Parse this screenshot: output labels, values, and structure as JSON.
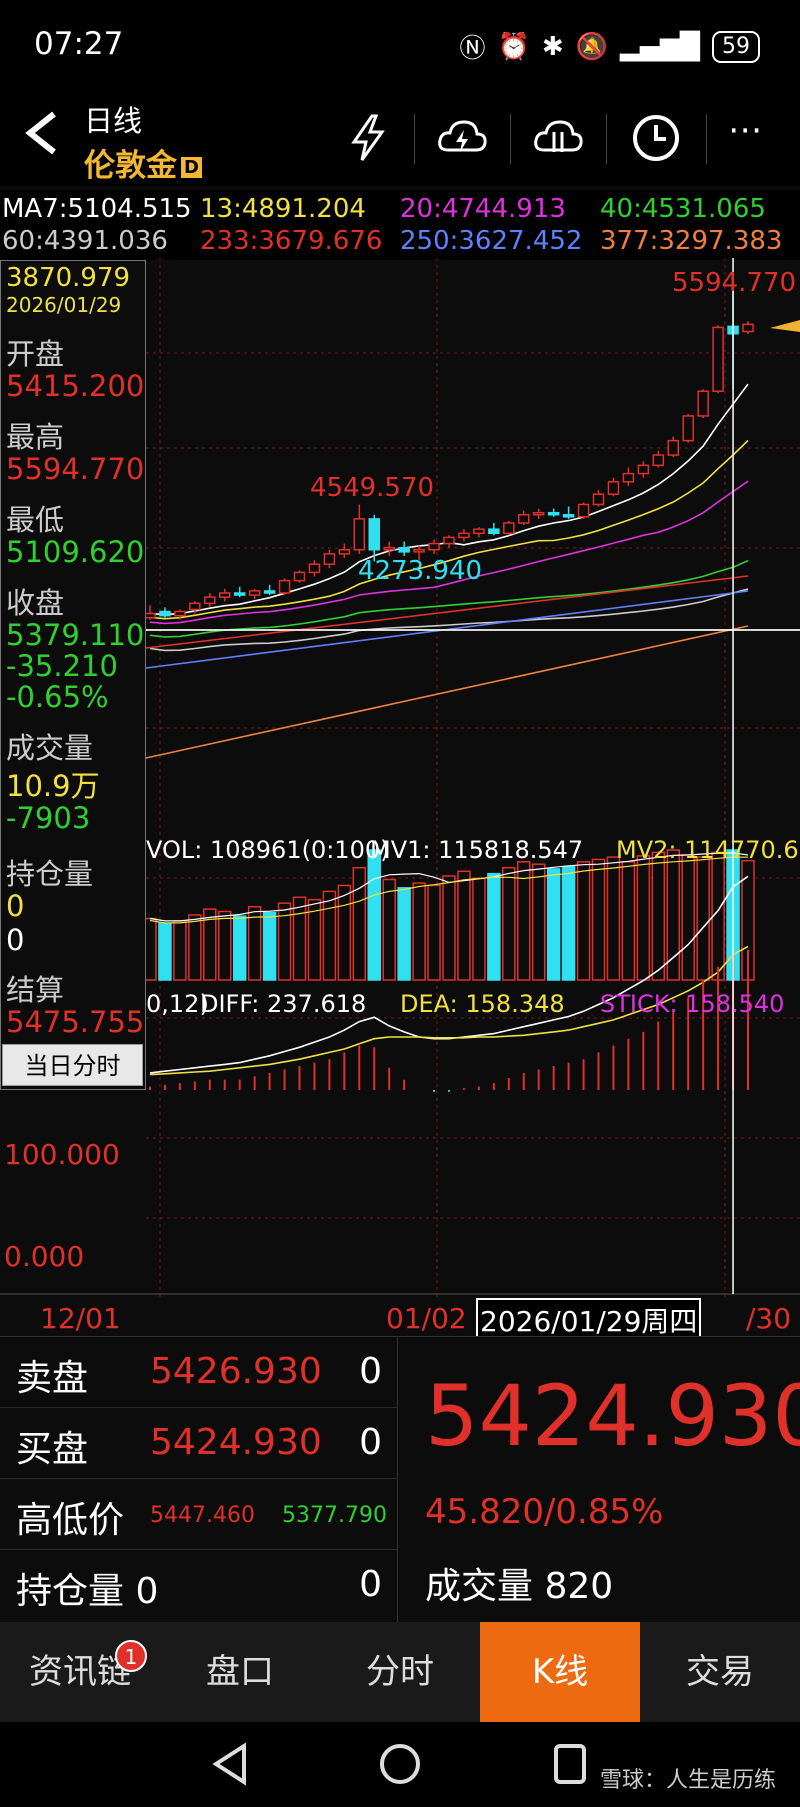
{
  "status": {
    "time": "07:27",
    "battery": "59"
  },
  "header": {
    "period": "日线",
    "instrument": "伦敦金",
    "badge": "D"
  },
  "ma_line1": [
    {
      "t": "MA7:5104.515",
      "c": "#ffffff"
    },
    {
      "t": "13:4891.204",
      "c": "#f0e040"
    },
    {
      "t": "20:4744.913",
      "c": "#e030e0"
    },
    {
      "t": "40:4531.065",
      "c": "#30d030"
    }
  ],
  "ma_line2": [
    {
      "t": "60:4391.036",
      "c": "#cccccc"
    },
    {
      "t": "233:3679.676",
      "c": "#e0302a"
    },
    {
      "t": "250:3627.452",
      "c": "#6080ff"
    },
    {
      "t": "377:3297.383",
      "c": "#f08040"
    }
  ],
  "info": {
    "price": "3870.979",
    "date": "2026/01/29",
    "open_label": "开盘",
    "open": "5415.200",
    "high_label": "最高",
    "high": "5594.770",
    "low_label": "最低",
    "low": "5109.620",
    "close_label": "收盘",
    "close": "5379.110",
    "change": "-35.210",
    "change_pct": "-0.65%",
    "volume_label": "成交量",
    "volume": "10.9万",
    "volume_change": "-7903",
    "oi_label": "持仓量",
    "oi": "0",
    "oi_change": "0",
    "settle_label": "结算",
    "settle": "5475.755",
    "intraday_button": "当日分时"
  },
  "chart_labels": {
    "max_mark": "5594.770",
    "peak_mark": "4549.570",
    "low_mark": "4273.940",
    "vol": "VOL: 108961(0:100)",
    "mv1": "MV1: 115818.547",
    "mv2": "MV2: 114770.625",
    "macd_param": "0,12)",
    "diff": "DIFF: 237.618",
    "dea": "DEA: 158.348",
    "stick": "STICK: 158.540",
    "macd_100": "100.000",
    "macd_0": "0.000",
    "x1": "12/01",
    "x2": "01/02",
    "x_cursor": "2026/01/29周四",
    "x3": "/30"
  },
  "chart_data": {
    "type": "candlestick",
    "candles": [
      {
        "o": 4000,
        "h": 4060,
        "l": 3990,
        "c": 4020
      },
      {
        "o": 4030,
        "h": 4050,
        "l": 4000,
        "c": 4010
      },
      {
        "o": 4010,
        "h": 4040,
        "l": 3990,
        "c": 4030
      },
      {
        "o": 4040,
        "h": 4080,
        "l": 4020,
        "c": 4070
      },
      {
        "o": 4070,
        "h": 4120,
        "l": 4050,
        "c": 4100
      },
      {
        "o": 4100,
        "h": 4140,
        "l": 4080,
        "c": 4120
      },
      {
        "o": 4120,
        "h": 4150,
        "l": 4100,
        "c": 4110
      },
      {
        "o": 4110,
        "h": 4140,
        "l": 4090,
        "c": 4130
      },
      {
        "o": 4130,
        "h": 4160,
        "l": 4110,
        "c": 4120
      },
      {
        "o": 4120,
        "h": 4190,
        "l": 4110,
        "c": 4180
      },
      {
        "o": 4180,
        "h": 4230,
        "l": 4170,
        "c": 4220
      },
      {
        "o": 4220,
        "h": 4280,
        "l": 4200,
        "c": 4260
      },
      {
        "o": 4260,
        "h": 4330,
        "l": 4240,
        "c": 4310
      },
      {
        "o": 4310,
        "h": 4360,
        "l": 4290,
        "c": 4330
      },
      {
        "o": 4330,
        "h": 4549.57,
        "l": 4310,
        "c": 4480
      },
      {
        "o": 4480,
        "h": 4500,
        "l": 4273.94,
        "c": 4330
      },
      {
        "o": 4330,
        "h": 4370,
        "l": 4300,
        "c": 4340
      },
      {
        "o": 4340,
        "h": 4370,
        "l": 4300,
        "c": 4320
      },
      {
        "o": 4320,
        "h": 4350,
        "l": 4280,
        "c": 4330
      },
      {
        "o": 4330,
        "h": 4380,
        "l": 4310,
        "c": 4360
      },
      {
        "o": 4360,
        "h": 4400,
        "l": 4340,
        "c": 4390
      },
      {
        "o": 4390,
        "h": 4430,
        "l": 4370,
        "c": 4410
      },
      {
        "o": 4410,
        "h": 4440,
        "l": 4390,
        "c": 4430
      },
      {
        "o": 4430,
        "h": 4460,
        "l": 4400,
        "c": 4410
      },
      {
        "o": 4410,
        "h": 4470,
        "l": 4400,
        "c": 4460
      },
      {
        "o": 4460,
        "h": 4520,
        "l": 4450,
        "c": 4500
      },
      {
        "o": 4500,
        "h": 4530,
        "l": 4480,
        "c": 4510
      },
      {
        "o": 4510,
        "h": 4530,
        "l": 4490,
        "c": 4500
      },
      {
        "o": 4500,
        "h": 4540,
        "l": 4480,
        "c": 4490
      },
      {
        "o": 4490,
        "h": 4560,
        "l": 4480,
        "c": 4550
      },
      {
        "o": 4550,
        "h": 4620,
        "l": 4540,
        "c": 4600
      },
      {
        "o": 4600,
        "h": 4680,
        "l": 4590,
        "c": 4660
      },
      {
        "o": 4660,
        "h": 4730,
        "l": 4640,
        "c": 4700
      },
      {
        "o": 4700,
        "h": 4760,
        "l": 4680,
        "c": 4740
      },
      {
        "o": 4740,
        "h": 4810,
        "l": 4730,
        "c": 4790
      },
      {
        "o": 4790,
        "h": 4880,
        "l": 4780,
        "c": 4860
      },
      {
        "o": 4860,
        "h": 4990,
        "l": 4850,
        "c": 4980
      },
      {
        "o": 4980,
        "h": 5110,
        "l": 4970,
        "c": 5100
      },
      {
        "o": 5100,
        "h": 5420,
        "l": 5090,
        "c": 5410
      },
      {
        "o": 5415.2,
        "h": 5594.77,
        "l": 5109.62,
        "c": 5379.11
      },
      {
        "o": 5390,
        "h": 5440,
        "l": 5377.79,
        "c": 5424.93
      }
    ],
    "price_range": [
      3950,
      5650
    ],
    "volumes": [
      52,
      48,
      50,
      55,
      60,
      58,
      54,
      62,
      57,
      65,
      70,
      68,
      75,
      80,
      95,
      110,
      85,
      78,
      82,
      80,
      88,
      92,
      86,
      90,
      95,
      100,
      98,
      94,
      96,
      100,
      102,
      104,
      100,
      105,
      108,
      110,
      106,
      104,
      108,
      110,
      101
    ],
    "macd_diff": [
      20,
      22,
      24,
      26,
      28,
      30,
      32,
      36,
      40,
      45,
      50,
      56,
      62,
      70,
      80,
      85,
      75,
      68,
      62,
      60,
      60,
      62,
      64,
      66,
      70,
      74,
      78,
      82,
      86,
      92,
      100,
      108,
      118,
      128,
      140,
      155,
      170,
      190,
      210,
      237.6,
      250
    ],
    "macd_dea": [
      18,
      19,
      20,
      21,
      22,
      24,
      26,
      28,
      30,
      33,
      36,
      40,
      44,
      48,
      54,
      60,
      62,
      62,
      62,
      61,
      61,
      61,
      62,
      62,
      63,
      64,
      66,
      68,
      70,
      74,
      78,
      82,
      88,
      94,
      100,
      108,
      116,
      126,
      138,
      158.3,
      168
    ],
    "macd_stick": [
      4,
      6,
      8,
      10,
      12,
      12,
      12,
      16,
      20,
      24,
      28,
      32,
      36,
      44,
      52,
      50,
      26,
      12,
      0,
      -2,
      -2,
      2,
      4,
      8,
      14,
      20,
      24,
      28,
      32,
      36,
      44,
      52,
      60,
      68,
      80,
      94,
      108,
      128,
      144,
      158.5,
      164
    ],
    "ma_vals": {
      "MA7": 5104.515,
      "MA13": 4891.204,
      "MA20": 4744.913,
      "MA40": 4531.065,
      "MA60": 4391.036,
      "MA233": 3679.676,
      "MA250": 3627.452,
      "MA377": 3297.383
    }
  },
  "bottom": {
    "sell_label": "卖盘",
    "sell_price": "5426.930",
    "sell_qty": "0",
    "buy_label": "买盘",
    "buy_price": "5424.930",
    "buy_qty": "0",
    "hl_label": "高低价",
    "hl_high": "5447.460",
    "hl_low": "5377.790",
    "oi_label": "持仓量",
    "oi_a": "0",
    "oi_b": "0",
    "last": "5424.930",
    "change": "45.820/0.85%",
    "volume_label": "成交量",
    "volume": "820"
  },
  "tabs": [
    "资讯链",
    "盘口",
    "分时",
    "K线",
    "交易"
  ],
  "tab_badge": "1",
  "watermark": "雪球：人生是历练"
}
